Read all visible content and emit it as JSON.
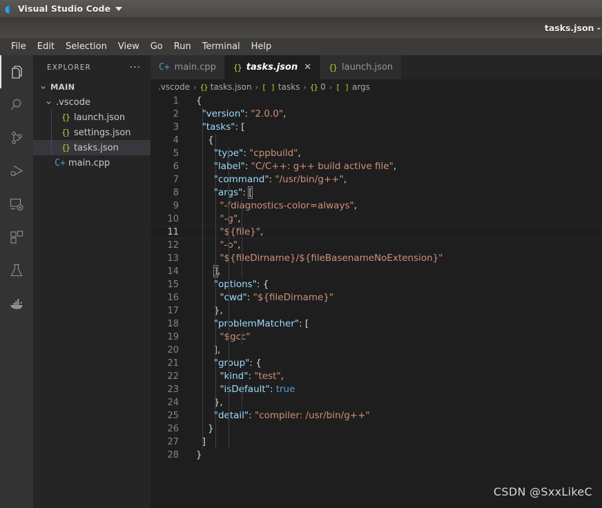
{
  "titlebar": {
    "app_name": "Visual Studio Code",
    "logo_icon": "vscode-logo-icon",
    "caret_icon": "chevron-down-icon"
  },
  "window": {
    "title": "tasks.json -"
  },
  "menubar": {
    "items": [
      {
        "label": "File"
      },
      {
        "label": "Edit"
      },
      {
        "label": "Selection"
      },
      {
        "label": "View"
      },
      {
        "label": "Go"
      },
      {
        "label": "Run"
      },
      {
        "label": "Terminal"
      },
      {
        "label": "Help"
      }
    ]
  },
  "activitybar": {
    "items": [
      {
        "name": "explorer-icon",
        "active": true
      },
      {
        "name": "search-icon",
        "active": false
      },
      {
        "name": "source-control-icon",
        "active": false
      },
      {
        "name": "run-and-debug-icon",
        "active": false
      },
      {
        "name": "remote-explorer-icon",
        "active": false
      },
      {
        "name": "extensions-icon",
        "active": false
      },
      {
        "name": "testing-flask-icon",
        "active": false
      },
      {
        "name": "docker-icon",
        "active": false
      }
    ]
  },
  "sidebar": {
    "header": {
      "title": "EXPLORER",
      "more_actions": "···"
    },
    "tree": [
      {
        "label": "MAIN",
        "icon": "",
        "depth": 0,
        "expanded": true,
        "selected": false
      },
      {
        "label": ".vscode",
        "icon": "",
        "depth": 1,
        "expanded": true,
        "selected": false
      },
      {
        "label": "launch.json",
        "icon": "{}",
        "depth": 2,
        "expanded": null,
        "selected": false
      },
      {
        "label": "settings.json",
        "icon": "{}",
        "depth": 2,
        "expanded": null,
        "selected": false
      },
      {
        "label": "tasks.json",
        "icon": "{}",
        "depth": 2,
        "expanded": null,
        "selected": true
      },
      {
        "label": "main.cpp",
        "icon": "C+",
        "depth": 1,
        "expanded": null,
        "selected": false
      }
    ]
  },
  "tabs": [
    {
      "label": "main.cpp",
      "icon": "C+",
      "icon_kind": "cpp",
      "active": false,
      "closable": false
    },
    {
      "label": "tasks.json",
      "icon": "{}",
      "icon_kind": "json",
      "active": true,
      "closable": true,
      "close_label": "✕"
    },
    {
      "label": "launch.json",
      "icon": "{}",
      "icon_kind": "json",
      "active": false,
      "closable": false
    }
  ],
  "breadcrumb": [
    {
      "icon": "",
      "icon_kind": "",
      "label": ".vscode"
    },
    {
      "icon": "{}",
      "icon_kind": "json",
      "label": "tasks.json"
    },
    {
      "icon": "[ ]",
      "icon_kind": "arr",
      "label": "tasks"
    },
    {
      "icon": "{}",
      "icon_kind": "json",
      "label": "0"
    },
    {
      "icon": "[ ]",
      "icon_kind": "arr",
      "label": "args"
    }
  ],
  "breadcrumb_separator": "›",
  "editor": {
    "language": "json",
    "filename": "tasks.json",
    "current_line": 11,
    "total_lines": 28,
    "lines": [
      {
        "n": 1,
        "indent": 0,
        "tokens": [
          {
            "t": "{",
            "c": "p"
          }
        ]
      },
      {
        "n": 2,
        "indent": 1,
        "tokens": [
          {
            "t": "\"version\"",
            "c": "k"
          },
          {
            "t": ": ",
            "c": "p"
          },
          {
            "t": "\"2.0.0\"",
            "c": "s"
          },
          {
            "t": ",",
            "c": "p"
          }
        ]
      },
      {
        "n": 3,
        "indent": 1,
        "tokens": [
          {
            "t": "\"tasks\"",
            "c": "k"
          },
          {
            "t": ": [",
            "c": "p"
          }
        ]
      },
      {
        "n": 4,
        "indent": 2,
        "tokens": [
          {
            "t": "{",
            "c": "p"
          }
        ]
      },
      {
        "n": 5,
        "indent": 3,
        "tokens": [
          {
            "t": "\"type\"",
            "c": "k"
          },
          {
            "t": ": ",
            "c": "p"
          },
          {
            "t": "\"cppbuild\"",
            "c": "s"
          },
          {
            "t": ",",
            "c": "p"
          }
        ]
      },
      {
        "n": 6,
        "indent": 3,
        "tokens": [
          {
            "t": "\"label\"",
            "c": "k"
          },
          {
            "t": ": ",
            "c": "p"
          },
          {
            "t": "\"C/C++: g++ build active file\"",
            "c": "s"
          },
          {
            "t": ",",
            "c": "p"
          }
        ]
      },
      {
        "n": 7,
        "indent": 3,
        "tokens": [
          {
            "t": "\"command\"",
            "c": "k"
          },
          {
            "t": ": ",
            "c": "p"
          },
          {
            "t": "\"/usr/bin/g++\"",
            "c": "s"
          },
          {
            "t": ",",
            "c": "p"
          }
        ]
      },
      {
        "n": 8,
        "indent": 3,
        "tokens": [
          {
            "t": "\"args\"",
            "c": "k"
          },
          {
            "t": ": ",
            "c": "p"
          },
          {
            "t": "[",
            "c": "p bmatch"
          }
        ]
      },
      {
        "n": 9,
        "indent": 4,
        "tokens": [
          {
            "t": "\"-fdiagnostics-color=always\"",
            "c": "s"
          },
          {
            "t": ",",
            "c": "p"
          }
        ]
      },
      {
        "n": 10,
        "indent": 4,
        "tokens": [
          {
            "t": "\"-g\"",
            "c": "s"
          },
          {
            "t": ",",
            "c": "p"
          }
        ]
      },
      {
        "n": 11,
        "indent": 4,
        "tokens": [
          {
            "t": "\"${file}\"",
            "c": "s"
          },
          {
            "t": ",",
            "c": "p"
          }
        ]
      },
      {
        "n": 12,
        "indent": 4,
        "tokens": [
          {
            "t": "\"-o\"",
            "c": "s"
          },
          {
            "t": ",",
            "c": "p"
          }
        ]
      },
      {
        "n": 13,
        "indent": 4,
        "tokens": [
          {
            "t": "\"${fileDirname}/${fileBasenameNoExtension}\"",
            "c": "s"
          }
        ]
      },
      {
        "n": 14,
        "indent": 3,
        "tokens": [
          {
            "t": "]",
            "c": "p bmatch"
          },
          {
            "t": ",",
            "c": "p"
          }
        ]
      },
      {
        "n": 15,
        "indent": 3,
        "tokens": [
          {
            "t": "\"options\"",
            "c": "k"
          },
          {
            "t": ": {",
            "c": "p"
          }
        ]
      },
      {
        "n": 16,
        "indent": 4,
        "tokens": [
          {
            "t": "\"cwd\"",
            "c": "k"
          },
          {
            "t": ": ",
            "c": "p"
          },
          {
            "t": "\"${fileDirname}\"",
            "c": "s"
          }
        ]
      },
      {
        "n": 17,
        "indent": 3,
        "tokens": [
          {
            "t": "},",
            "c": "p"
          }
        ]
      },
      {
        "n": 18,
        "indent": 3,
        "tokens": [
          {
            "t": "\"problemMatcher\"",
            "c": "k"
          },
          {
            "t": ": [",
            "c": "p"
          }
        ]
      },
      {
        "n": 19,
        "indent": 4,
        "tokens": [
          {
            "t": "\"$gcc\"",
            "c": "s"
          }
        ]
      },
      {
        "n": 20,
        "indent": 3,
        "tokens": [
          {
            "t": "],",
            "c": "p"
          }
        ]
      },
      {
        "n": 21,
        "indent": 3,
        "tokens": [
          {
            "t": "\"group\"",
            "c": "k"
          },
          {
            "t": ": {",
            "c": "p"
          }
        ]
      },
      {
        "n": 22,
        "indent": 4,
        "tokens": [
          {
            "t": "\"kind\"",
            "c": "k"
          },
          {
            "t": ": ",
            "c": "p"
          },
          {
            "t": "\"test\"",
            "c": "s"
          },
          {
            "t": ",",
            "c": "p"
          }
        ]
      },
      {
        "n": 23,
        "indent": 4,
        "tokens": [
          {
            "t": "\"isDefault\"",
            "c": "k"
          },
          {
            "t": ": ",
            "c": "p"
          },
          {
            "t": "true",
            "c": "b"
          }
        ]
      },
      {
        "n": 24,
        "indent": 3,
        "tokens": [
          {
            "t": "},",
            "c": "p"
          }
        ]
      },
      {
        "n": 25,
        "indent": 3,
        "tokens": [
          {
            "t": "\"detail\"",
            "c": "k"
          },
          {
            "t": ": ",
            "c": "p"
          },
          {
            "t": "\"compiler: /usr/bin/g++\"",
            "c": "s"
          }
        ]
      },
      {
        "n": 26,
        "indent": 2,
        "tokens": [
          {
            "t": "}",
            "c": "p"
          }
        ]
      },
      {
        "n": 27,
        "indent": 1,
        "tokens": [
          {
            "t": "]",
            "c": "p"
          }
        ]
      },
      {
        "n": 28,
        "indent": 0,
        "tokens": [
          {
            "t": "}",
            "c": "p"
          }
        ]
      }
    ]
  },
  "watermark": {
    "text": "CSDN @SxxLikeC"
  },
  "colors": {
    "editor_bg": "#1e1e1e",
    "sidebar_bg": "#252526",
    "activitybar_bg": "#333333",
    "titlebar_bg": "#4b4945",
    "menubar_bg": "#3c3b37",
    "tab_active_bg": "#1e1e1e",
    "tab_inactive_bg": "#2d2d2d",
    "selected_row_bg": "#37373d",
    "key_color": "#9cdcfe",
    "string_color": "#ce9178",
    "keyword_color": "#569cd6",
    "punctuation_color": "#d4d4d4",
    "json_icon_color": "#cbcb41",
    "cpp_icon_color": "#519aba",
    "line_number_color": "#858585"
  }
}
